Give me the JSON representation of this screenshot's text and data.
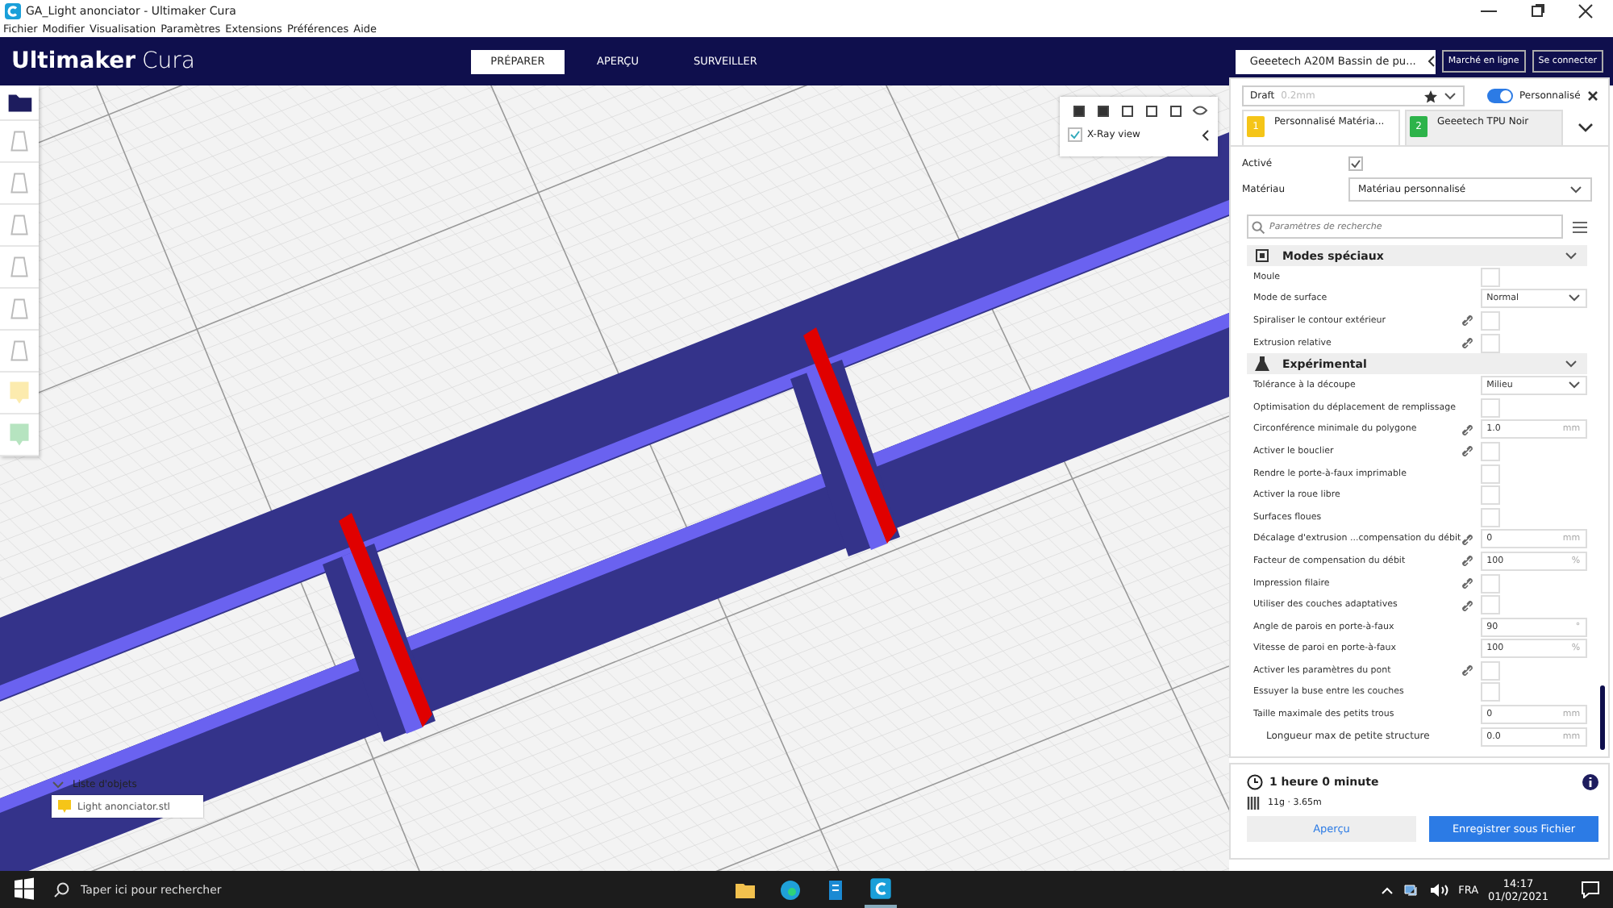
{
  "window": {
    "title": "GA_Light anonciator - Ultimaker Cura"
  },
  "menu": [
    "Fichier",
    "Modifier",
    "Visualisation",
    "Paramètres",
    "Extensions",
    "Préférences",
    "Aide"
  ],
  "header": {
    "logo_bold": "Ultimaker",
    "logo_light": "Cura",
    "stages": [
      {
        "label": "PRÉPARER",
        "selected": true
      },
      {
        "label": "APERÇU",
        "selected": false
      },
      {
        "label": "SURVEILLER",
        "selected": false
      }
    ],
    "printer": "Geeetech A20M Bassin de pu...",
    "buttons": [
      "Marché en ligne",
      "Se connecter"
    ]
  },
  "view_toolbar": {
    "xray": {
      "label": "X-Ray view",
      "checked": true
    }
  },
  "object_list": {
    "title": "Liste d'objets",
    "expanded": true,
    "items": [
      {
        "name": "Light anonciator.stl",
        "color": "#f5c518"
      }
    ]
  },
  "print_setup": {
    "profile": "Draft",
    "layer": "0.2mm",
    "mode_label": "Personnalisé",
    "custom": true,
    "extruder_tabs": [
      {
        "number": "1",
        "label": "Personnalisé Matéria...",
        "color": "#f5c518",
        "selected": true
      },
      {
        "number": "2",
        "label": "Geeetech TPU Noir",
        "color": "#2db34a",
        "selected": false
      }
    ],
    "enabled_label": "Activé",
    "enabled": true,
    "material_label": "Matériau",
    "material": "Matériau personnalisé",
    "search_placeholder": "Paramètres de recherche",
    "sections": [
      {
        "title": "Modes spéciaux",
        "expanded": true,
        "rows": [
          {
            "kind": "checkbox",
            "label": "Moule",
            "linked": false,
            "checked": false
          },
          {
            "kind": "select",
            "label": "Mode de surface",
            "linked": false,
            "value": "Normal"
          },
          {
            "kind": "checkbox",
            "label": "Spiraliser le contour extérieur",
            "linked": true,
            "checked": false
          },
          {
            "kind": "checkbox",
            "label": "Extrusion relative",
            "linked": true,
            "checked": false
          }
        ]
      },
      {
        "title": "Expérimental",
        "expanded": true,
        "rows": [
          {
            "kind": "select",
            "label": "Tolérance à la découpe",
            "linked": false,
            "value": "Milieu"
          },
          {
            "kind": "checkbox",
            "label": "Optimisation du déplacement de remplissage",
            "linked": false,
            "checked": false
          },
          {
            "kind": "number",
            "label": "Circonférence minimale du polygone",
            "linked": true,
            "value": "1.0",
            "unit": "mm"
          },
          {
            "kind": "checkbox",
            "label": "Activer le bouclier",
            "linked": true,
            "checked": false
          },
          {
            "kind": "checkbox",
            "label": "Rendre le porte-à-faux imprimable",
            "linked": false,
            "checked": false
          },
          {
            "kind": "checkbox",
            "label": "Activer la roue libre",
            "linked": false,
            "checked": false
          },
          {
            "kind": "checkbox",
            "label": "Surfaces floues",
            "linked": false,
            "checked": false
          },
          {
            "kind": "number",
            "label": "Décalage d'extrusion ...compensation du débit",
            "linked": true,
            "value": "0",
            "unit": "mm"
          },
          {
            "kind": "number",
            "label": "Facteur de compensation du débit",
            "linked": true,
            "value": "100",
            "unit": "%"
          },
          {
            "kind": "checkbox",
            "label": "Impression filaire",
            "linked": true,
            "checked": false
          },
          {
            "kind": "checkbox",
            "label": "Utiliser des couches adaptatives",
            "linked": true,
            "checked": false
          },
          {
            "kind": "number",
            "label": "Angle de parois en porte-à-faux",
            "linked": false,
            "value": "90",
            "unit": "°"
          },
          {
            "kind": "number",
            "label": "Vitesse de paroi en porte-à-faux",
            "linked": false,
            "value": "100",
            "unit": "%"
          },
          {
            "kind": "checkbox",
            "label": "Activer les paramètres du pont",
            "linked": true,
            "checked": false
          },
          {
            "kind": "checkbox",
            "label": "Essuyer la buse entre les couches",
            "linked": false,
            "checked": false
          },
          {
            "kind": "number",
            "label": "Taille maximale des petits trous",
            "linked": false,
            "value": "0",
            "unit": "mm",
            "children": [
              {
                "kind": "number",
                "label": "Longueur max de petite structure",
                "linked": false,
                "value": "0.0",
                "unit": "mm"
              }
            ]
          }
        ]
      }
    ]
  },
  "job": {
    "time": "1 heure 0 minute",
    "material": "11g · 3.65m",
    "buttons": [
      "Aperçu",
      "Enregistrer sous Fichier"
    ]
  },
  "taskbar": {
    "search_placeholder": "Taper ici pour rechercher",
    "language": "FRA",
    "time": "14:17",
    "date": "01/02/2021"
  }
}
